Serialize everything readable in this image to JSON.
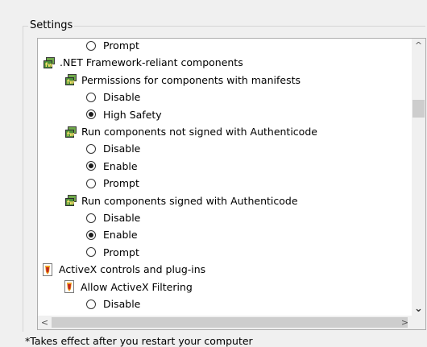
{
  "group": {
    "label": "Settings"
  },
  "tree": [
    {
      "kind": "radio",
      "level": 3,
      "label": "Prompt",
      "checked": false
    },
    {
      "kind": "category",
      "icon": "net-framework-icon",
      "level": 0,
      "label": ".NET Framework-reliant components"
    },
    {
      "kind": "setting",
      "icon": "net-framework-icon",
      "level": 1,
      "label": "Permissions for components with manifests"
    },
    {
      "kind": "radio",
      "level": 3,
      "label": "Disable",
      "checked": false
    },
    {
      "kind": "radio",
      "level": 3,
      "label": "High Safety",
      "checked": true
    },
    {
      "kind": "setting",
      "icon": "net-framework-icon",
      "level": 1,
      "label": "Run components not signed with Authenticode"
    },
    {
      "kind": "radio",
      "level": 3,
      "label": "Disable",
      "checked": false
    },
    {
      "kind": "radio",
      "level": 3,
      "label": "Enable",
      "checked": true
    },
    {
      "kind": "radio",
      "level": 3,
      "label": "Prompt",
      "checked": false
    },
    {
      "kind": "setting",
      "icon": "net-framework-icon",
      "level": 1,
      "label": "Run components signed with Authenticode"
    },
    {
      "kind": "radio",
      "level": 3,
      "label": "Disable",
      "checked": false
    },
    {
      "kind": "radio",
      "level": 3,
      "label": "Enable",
      "checked": true
    },
    {
      "kind": "radio",
      "level": 3,
      "label": "Prompt",
      "checked": false
    },
    {
      "kind": "category",
      "icon": "activex-icon",
      "level": 0,
      "label": "ActiveX controls and plug-ins"
    },
    {
      "kind": "setting",
      "icon": "activex-icon",
      "level": 1,
      "label": "Allow ActiveX Filtering"
    },
    {
      "kind": "radio",
      "level": 3,
      "label": "Disable",
      "checked": false
    }
  ],
  "scrollbars": {
    "up_arrow": "^",
    "down_arrow": "⌄",
    "left_arrow": "<",
    "right_arrow": ">"
  },
  "footer": {
    "note": "*Takes effect after you restart your computer"
  }
}
